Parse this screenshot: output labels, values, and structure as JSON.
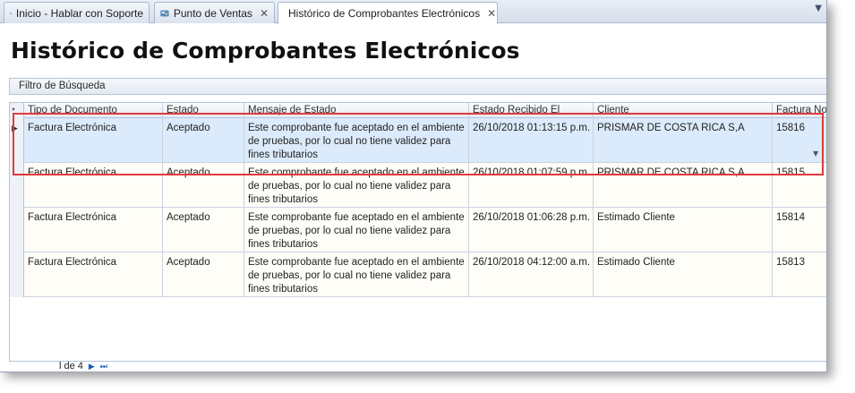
{
  "tabs": [
    {
      "label": "Inicio - Hablar con Soporte",
      "icon": "home-icon",
      "closable": false
    },
    {
      "label": "Punto de Ventas",
      "icon": "cashier-icon",
      "closable": true
    },
    {
      "label": "Histórico de Comprobantes Electrónicos",
      "icon": "document-icon",
      "closable": true
    }
  ],
  "close_glyph": "✕",
  "overflow_glyph": "▼",
  "page": {
    "title": "Histórico de Comprobantes Electrónicos",
    "filter_label": "Filtro de Búsqueda"
  },
  "grid": {
    "corner_glyph": "*",
    "columns": [
      "Tipo de Documento",
      "Estado",
      "Mensaje de Estado",
      "Estado Recibido El",
      "Cliente",
      "Factura No"
    ],
    "rows": [
      {
        "tipo": "Factura Electrónica",
        "estado": "Aceptado",
        "mensaje": "Este comprobante fue aceptado en el ambiente de pruebas, por lo cual no tiene validez para fines tributarios",
        "recibido": "26/10/2018 01:13:15 p.m.",
        "cliente": "PRISMAR DE COSTA RICA S,A",
        "factura": "15816"
      },
      {
        "tipo": "Factura Electrónica",
        "estado": "Aceptado",
        "mensaje": "Este comprobante fue aceptado en el ambiente de pruebas, por lo cual no tiene validez para fines tributarios",
        "recibido": "26/10/2018 01:07:59 p.m.",
        "cliente": "PRISMAR DE COSTA RICA S,A",
        "factura": "15815"
      },
      {
        "tipo": "Factura Electrónica",
        "estado": "Aceptado",
        "mensaje": "Este comprobante fue aceptado en el ambiente de pruebas, por lo cual no tiene validez para fines tributarios",
        "recibido": "26/10/2018 01:06:28 p.m.",
        "cliente": "Estimado Cliente",
        "factura": "15814"
      },
      {
        "tipo": "Factura Electrónica",
        "estado": "Aceptado",
        "mensaje": "Este comprobante fue aceptado en el ambiente de pruebas, por lo cual no tiene validez para fines tributarios",
        "recibido": "26/10/2018 04:12:00 a.m.",
        "cliente": "Estimado Cliente",
        "factura": "15813"
      }
    ],
    "selected_indicator": "▶"
  },
  "pager": {
    "info": "l de 4",
    "next_glyph": "▶",
    "last_glyph": "⏭"
  },
  "colors": {
    "highlight": "#e03a3a",
    "selected_row": "#dcebfb"
  }
}
